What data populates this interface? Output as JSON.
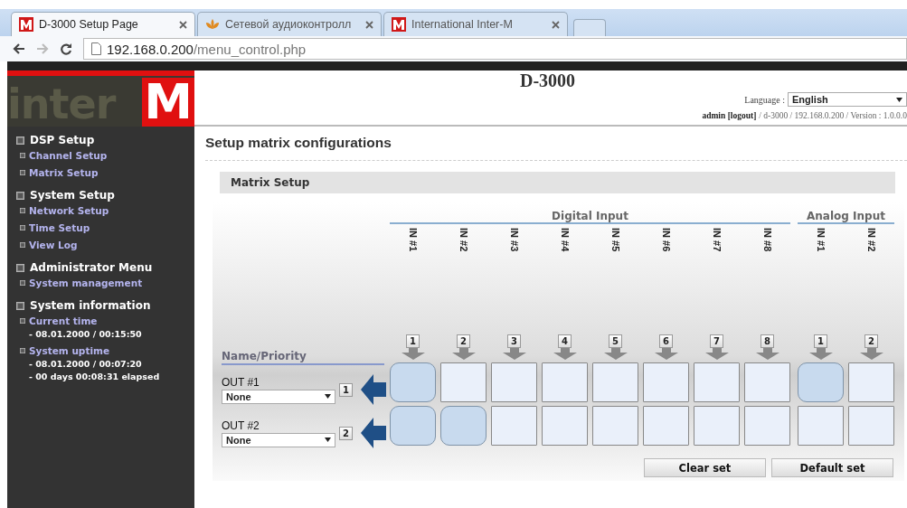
{
  "browser": {
    "tabs": [
      {
        "title": "D-3000 Setup Page",
        "kind": "m-logo",
        "selected": true
      },
      {
        "title": "Сетевой аудиоконтролл",
        "kind": "flower",
        "selected": false
      },
      {
        "title": "International Inter-M",
        "kind": "m-logo",
        "selected": false
      }
    ],
    "address": {
      "host": "192.168.0.200",
      "path": "/menu_control.php"
    }
  },
  "logo": {
    "text": "inter",
    "mark": "M"
  },
  "sidebar": {
    "sections": [
      {
        "title": "DSP Setup",
        "items": [
          {
            "label": "Channel Setup"
          },
          {
            "label": "Matrix Setup"
          }
        ]
      },
      {
        "title": "System Setup",
        "items": [
          {
            "label": "Network Setup"
          },
          {
            "label": "Time Setup"
          },
          {
            "label": "View Log"
          }
        ]
      },
      {
        "title": "Administrator Menu",
        "items": [
          {
            "label": "System management"
          }
        ]
      },
      {
        "title": "System information",
        "items": [
          {
            "label": "Current time",
            "values": [
              "- 08.01.2000 / 00:15:50"
            ]
          },
          {
            "label": "System uptime",
            "values": [
              "- 08.01.2000 / 00:07:20",
              "- 00 days 00:08:31 elapsed"
            ]
          }
        ]
      }
    ]
  },
  "header": {
    "title": "D-3000",
    "language_label": "Language :",
    "language": "English",
    "user": "admin",
    "logout": "[logout]",
    "info": "/ d-3000 / 192.168.0.200 / Version : 1.0.0.0"
  },
  "page_title": "Setup matrix configurations",
  "section_title": "Matrix Setup",
  "matrix": {
    "name_header": "Name/Priority",
    "groups": [
      {
        "title": "Digital Input",
        "inputs": [
          {
            "label": "IN #1",
            "number": "1"
          },
          {
            "label": "IN #2",
            "number": "2"
          },
          {
            "label": "IN #3",
            "number": "3"
          },
          {
            "label": "IN #4",
            "number": "4"
          },
          {
            "label": "IN #5",
            "number": "5"
          },
          {
            "label": "IN #6",
            "number": "6"
          },
          {
            "label": "IN #7",
            "number": "7"
          },
          {
            "label": "IN #8",
            "number": "8"
          }
        ]
      },
      {
        "title": "Analog Input",
        "inputs": [
          {
            "label": "IN #1",
            "number": "1"
          },
          {
            "label": "IN #2",
            "number": "2"
          }
        ]
      }
    ],
    "outputs": [
      {
        "label": "OUT #1",
        "name": "None",
        "priority": "1",
        "routes": [
          [
            true,
            false,
            false,
            false,
            false,
            false,
            false,
            false
          ],
          [
            true,
            false
          ]
        ]
      },
      {
        "label": "OUT #2",
        "name": "None",
        "priority": "2",
        "routes": [
          [
            true,
            true,
            false,
            false,
            false,
            false,
            false,
            false
          ],
          [
            false,
            false
          ]
        ]
      }
    ]
  },
  "buttons": [
    "Clear set",
    "Default set"
  ]
}
